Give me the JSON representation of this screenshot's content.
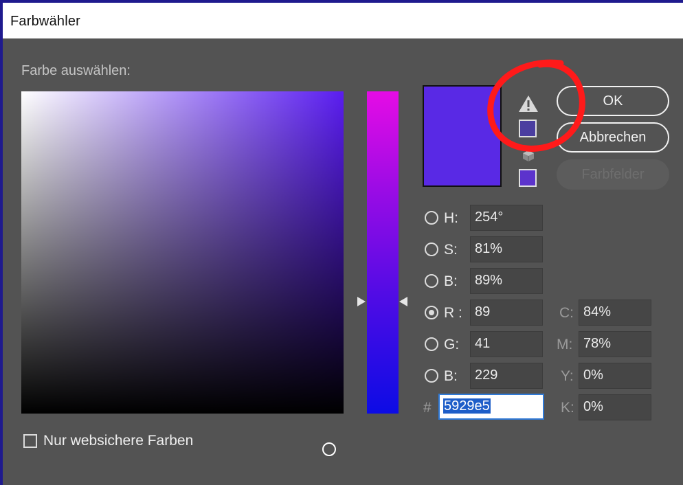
{
  "window": {
    "title": "Farbwähler"
  },
  "picker": {
    "section_label": "Farbe auswählen:"
  },
  "preview": {
    "color": "#5929e5",
    "gamut_swatch_color": "#4b3ea0",
    "web_swatch_color": "#5c33cc"
  },
  "icons": {
    "warning": "warning-triangle-icon",
    "cube": "cube-icon"
  },
  "buttons": {
    "ok": "OK",
    "cancel": "Abbrechen",
    "swatches": "Farbfelder"
  },
  "hsb": [
    {
      "label": "H:",
      "value": "254°"
    },
    {
      "label": "S:",
      "value": "81%"
    },
    {
      "label": "B:",
      "value": "89%"
    }
  ],
  "rgb": [
    {
      "label": "R :",
      "value": "89"
    },
    {
      "label": "G:",
      "value": "41"
    },
    {
      "label": "B:",
      "value": "229"
    }
  ],
  "cmyk": [
    {
      "label": "C:",
      "value": "84%"
    },
    {
      "label": "M:",
      "value": "78%"
    },
    {
      "label": "Y:",
      "value": "0%"
    },
    {
      "label": "K:",
      "value": "0%"
    }
  ],
  "hex": {
    "prefix": "#",
    "value": "5929e5"
  },
  "websafe": {
    "label": "Nur websichere Farben",
    "checked": false
  },
  "selected_mode": "R"
}
